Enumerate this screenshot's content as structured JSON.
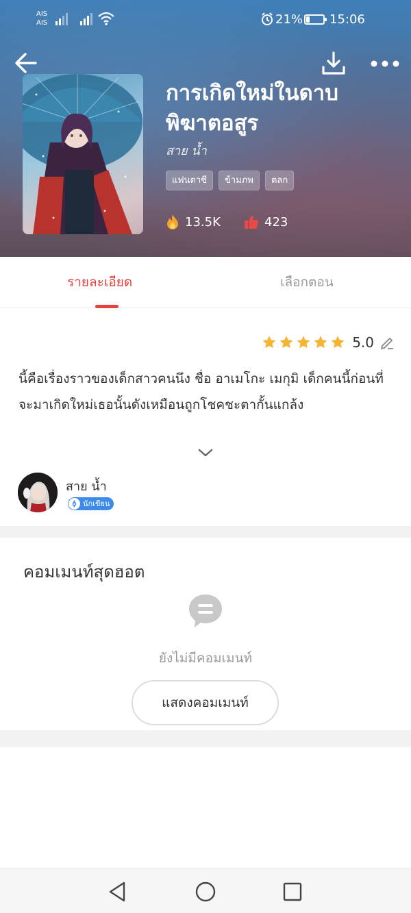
{
  "status_bar": {
    "carrier_1": "AIS",
    "carrier_2": "AIS",
    "battery_percent": "21%",
    "battery_level": 0.21,
    "time": "15:06"
  },
  "book": {
    "title": "การเกิดใหม่ในดาบพิฆาตอสูร",
    "author": "สาย น้ำ",
    "tags": [
      "แฟนตาซี",
      "ข้ามภพ",
      "ตลก"
    ],
    "views": "13.5K",
    "likes": "423",
    "rating": "5.0",
    "rating_stars": 5,
    "synopsis": "นี้คือเรื่องราวของเด็กสาวคนนึง ชื่อ อาเมโกะ เมกุมิ เด็กคนนี้ก่อนที่จะมาเกิดใหม่เธอนั้นดังเหมือนถูกโชคชะตากั้นแกล้ง"
  },
  "tabs": {
    "details": "รายละเอียด",
    "chapters": "เลือกตอน"
  },
  "author_card": {
    "name": "สาย น้ำ",
    "badge": "นักเขียน"
  },
  "comments": {
    "title": "คอมเมนท์สุดฮอต",
    "empty_text": "ยังไม่มีคอมเมนท์",
    "show_button": "แสดงคอมเมนท์"
  },
  "icons": {
    "back": "arrow-left-icon",
    "download": "download-icon",
    "more": "more-dots-icon",
    "views": "fire-icon",
    "likes": "thumbs-up-icon",
    "edit": "pencil-icon",
    "expand": "chevron-down-icon",
    "comment": "chat-bubble-icon"
  },
  "colors": {
    "accent": "#e3423f",
    "star": "#f5b532",
    "badge": "#3d8be8",
    "fire": "#f7a32b",
    "like": "#e84a4a"
  }
}
